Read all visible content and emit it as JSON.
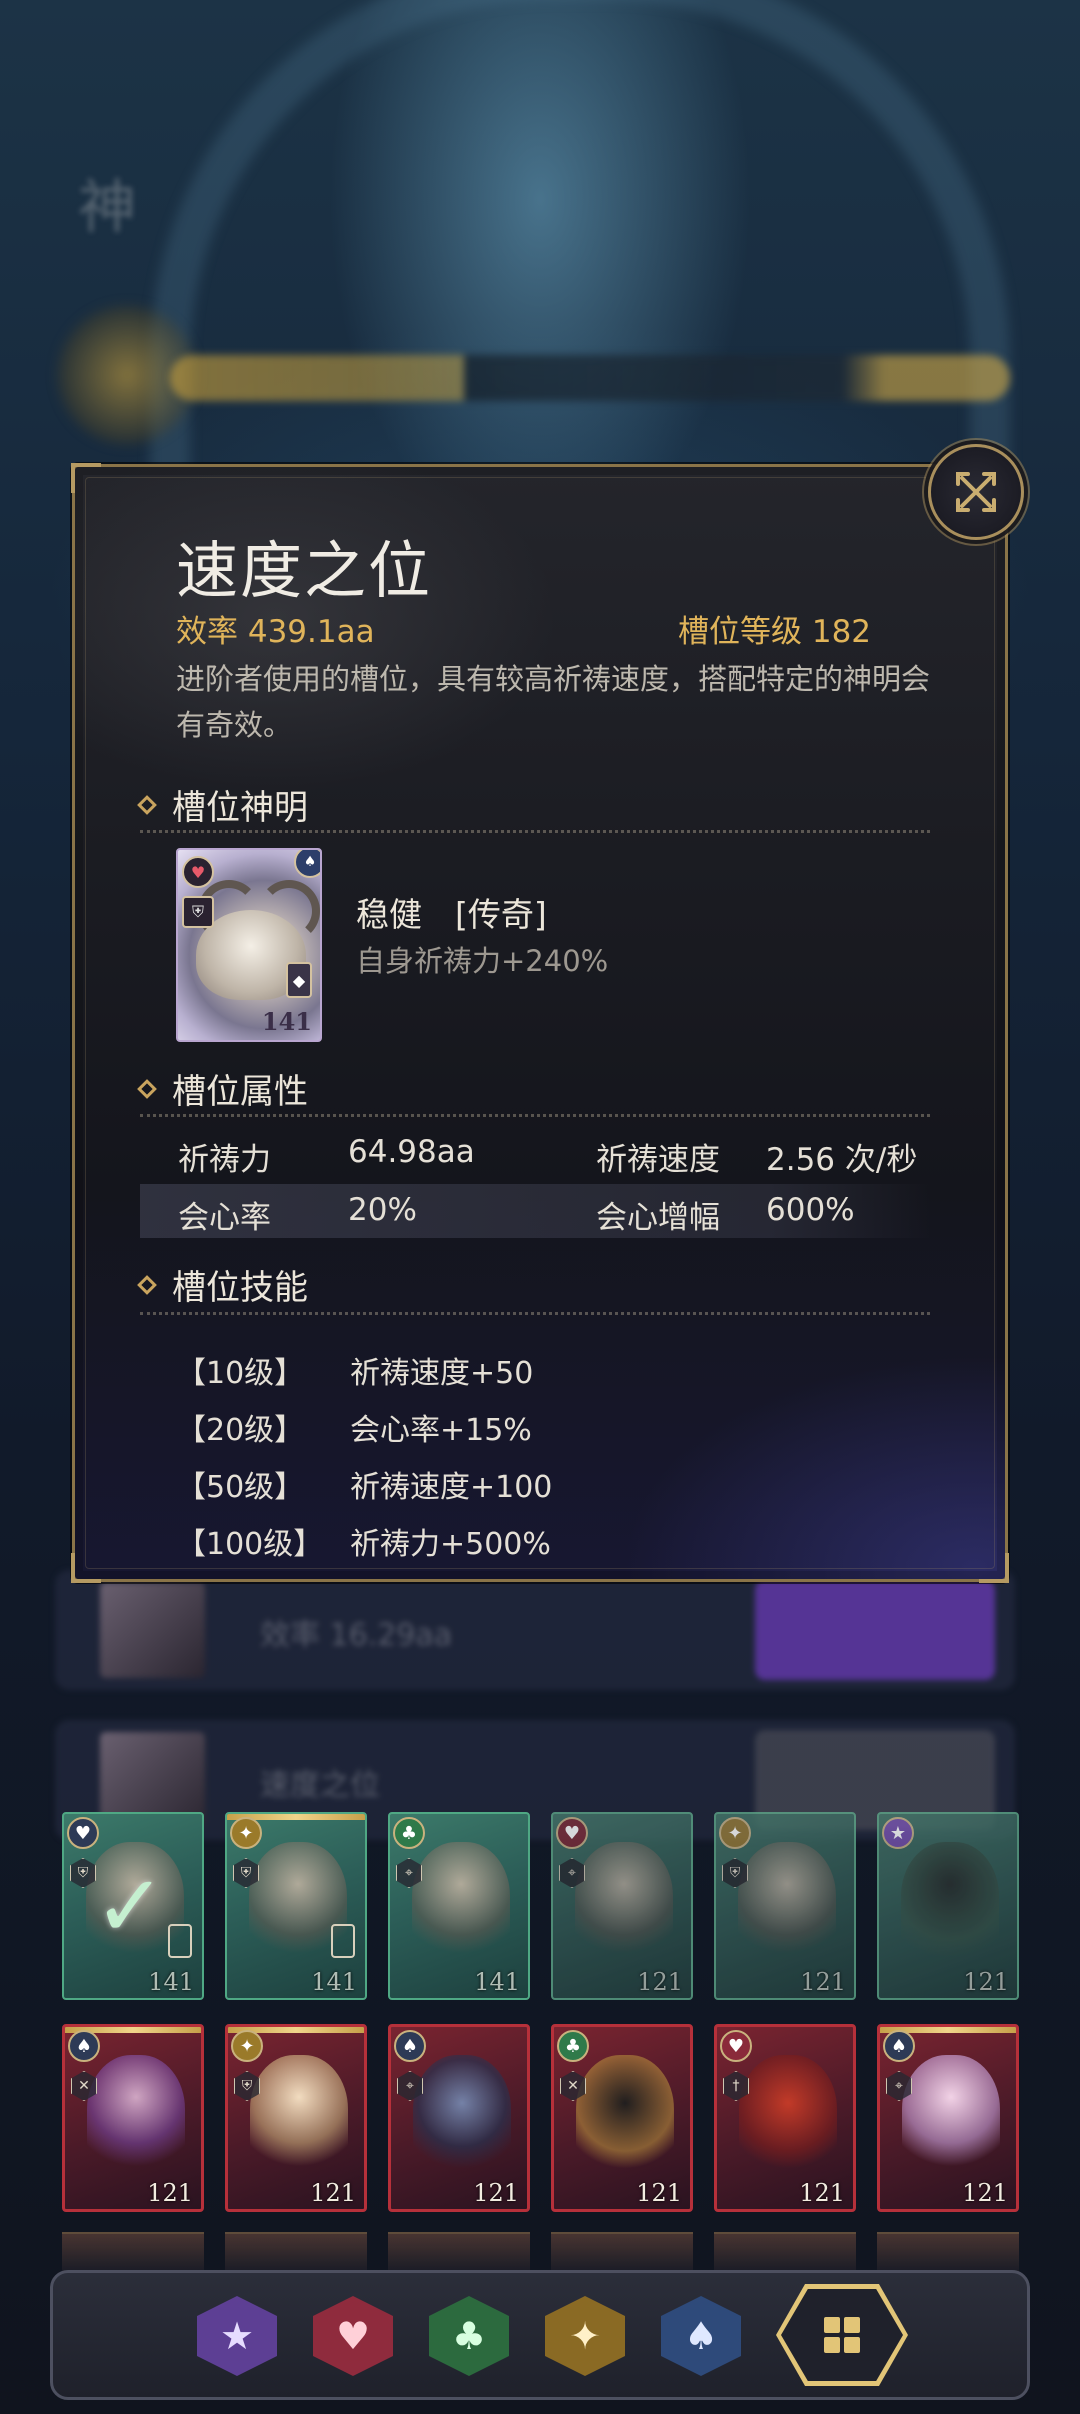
{
  "background": {
    "title_char": "神",
    "row1_text": "效率 16.29aa",
    "row2_text": "速度之位"
  },
  "slot": {
    "title": "速度之位",
    "efficiency": "效率 439.1aa",
    "level": "槽位等级 182",
    "description": "进阶者使用的槽位，具有较高祈祷速度，搭配特定的神明会有奇效。"
  },
  "god_section": {
    "heading": "槽位神明",
    "card_level": "141",
    "name": "稳健　[传奇]",
    "effect": "自身祈祷力+240%"
  },
  "attr_section": {
    "heading": "槽位属性",
    "rows": [
      {
        "k1": "祈祷力",
        "v1": "64.98aa",
        "k2": "祈祷速度",
        "v2": "2.56 次/秒"
      },
      {
        "k1": "会心率",
        "v1": "20%",
        "k2": "会心增幅",
        "v2": "600%"
      }
    ]
  },
  "skill_section": {
    "heading": "槽位技能",
    "skills": [
      {
        "level": "【10级】",
        "effect": "祈祷速度+50"
      },
      {
        "level": "【20级】",
        "effect": "会心率+15%"
      },
      {
        "level": "【50级】",
        "effect": "祈祷速度+100"
      },
      {
        "level": "【100级】",
        "effect": "祈祷力+500%"
      }
    ]
  },
  "cards_row1": [
    "141",
    "141",
    "141",
    "121",
    "121",
    "121"
  ],
  "cards_row2": [
    "121",
    "121",
    "121",
    "121",
    "121",
    "121"
  ],
  "filters": [
    "star-suit",
    "heart-suit",
    "club-suit",
    "diamond-suit",
    "spade-suit",
    "all-suits"
  ],
  "colors": {
    "accent_gold": "#e0b45a",
    "frame_gold": "#8a7448",
    "selected_filter": "#e2c577"
  }
}
